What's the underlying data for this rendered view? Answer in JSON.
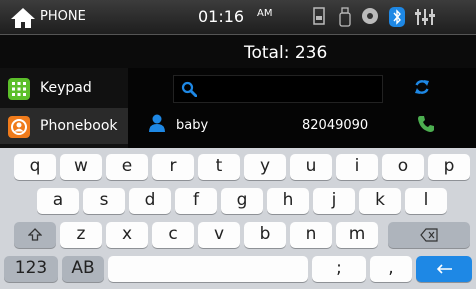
{
  "status": {
    "title": "PHONE",
    "time": "01:16",
    "ampm": "AM",
    "icons": [
      "home-icon",
      "sd-card-icon",
      "usb-icon",
      "disc-icon",
      "bluetooth-icon",
      "equalizer-icon"
    ]
  },
  "header": {
    "total": "Total: 236"
  },
  "sidebar": {
    "items": [
      {
        "label": "Keypad",
        "icon": "keypad-icon",
        "color": "#5cbf2a"
      },
      {
        "label": "Phonebook",
        "icon": "phonebook-icon",
        "color": "#f07b1b"
      }
    ]
  },
  "search": {
    "placeholder": ""
  },
  "contact": {
    "name": "baby",
    "number": "82049090"
  },
  "keyboard": {
    "row1": [
      "q",
      "w",
      "e",
      "r",
      "t",
      "y",
      "u",
      "i",
      "o",
      "p"
    ],
    "row2": [
      "a",
      "s",
      "d",
      "f",
      "g",
      "h",
      "j",
      "k",
      "l"
    ],
    "row3": [
      "z",
      "x",
      "c",
      "v",
      "b",
      "n",
      "m"
    ],
    "row4": {
      "num": "123",
      "ab": "AB",
      "semicolon": ";",
      "comma": ","
    }
  },
  "colors": {
    "accent": "#1e88e5",
    "call": "#4caf50",
    "keypad": "#5cbf2a",
    "phonebook": "#f07b1b"
  }
}
